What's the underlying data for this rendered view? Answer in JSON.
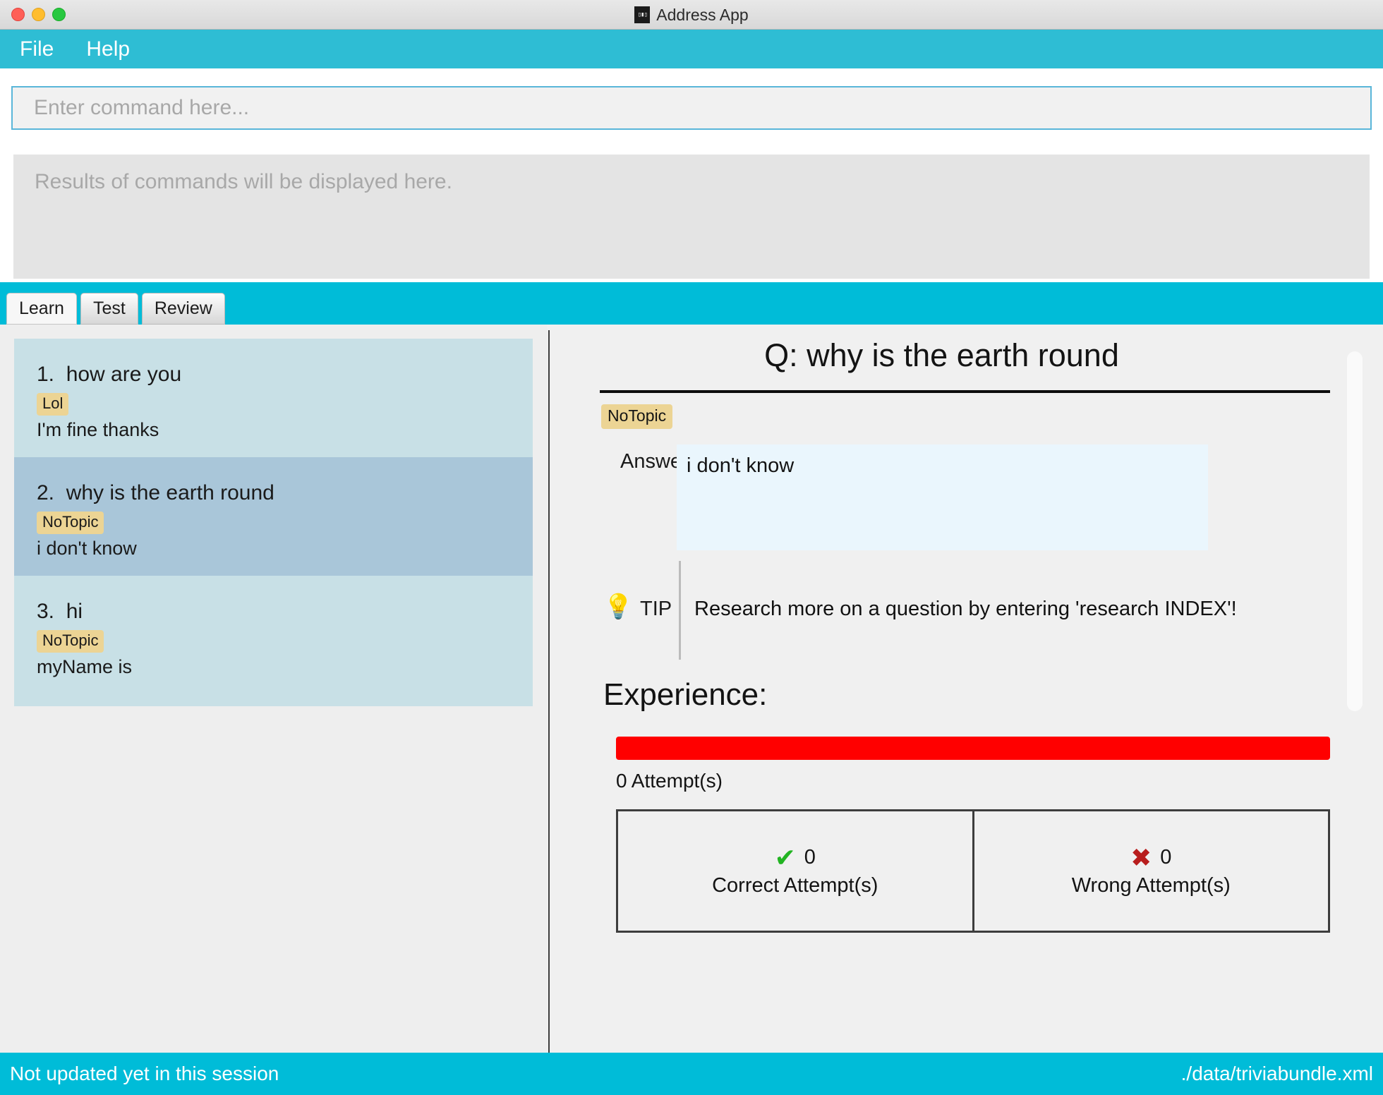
{
  "window": {
    "title": "Address App",
    "app_icon": "app-icon",
    "traffic_lights": [
      "close-red",
      "minimize-yellow",
      "zoom-green"
    ]
  },
  "menubar": {
    "items": [
      {
        "label": "File"
      },
      {
        "label": "Help"
      }
    ]
  },
  "command": {
    "value": "",
    "placeholder": "Enter command here..."
  },
  "result": {
    "placeholder": "Results of commands will be displayed here."
  },
  "tabs": [
    {
      "label": "Learn",
      "active": true
    },
    {
      "label": "Test",
      "active": false
    },
    {
      "label": "Review",
      "active": false
    }
  ],
  "list": {
    "items": [
      {
        "index": "1.",
        "question": "how are you",
        "tag": "Lol",
        "answer": "I'm fine thanks",
        "selected": false
      },
      {
        "index": "2.",
        "question": "why is the earth round",
        "tag": "NoTopic",
        "answer": "i don't know",
        "selected": true
      },
      {
        "index": "3.",
        "question": "hi",
        "tag": "NoTopic",
        "answer": "myName is",
        "selected": false
      }
    ]
  },
  "detail": {
    "question_heading": "Q: why is the earth round",
    "topic_tag": "NoTopic",
    "answer_label": "Answer:",
    "answer_text": "i don't know",
    "tip": {
      "icon": "lightbulb-icon",
      "label": "TIP",
      "text": "Research more on a question by entering 'research INDEX'!"
    },
    "experience": {
      "heading": "Experience:",
      "bar_color": "#ff0000",
      "bar_fill_percent": 100,
      "attempts_text": "0 Attempt(s)"
    },
    "attempt_stats": [
      {
        "icon": "check-icon",
        "count": "0",
        "label": "Correct Attempt(s)",
        "color": "#22b422"
      },
      {
        "icon": "cross-icon",
        "count": "0",
        "label": "Wrong Attempt(s)",
        "color": "#b81d1d"
      }
    ]
  },
  "statusbar": {
    "left": "Not updated yet in this session",
    "right": "./data/triviabundle.xml"
  },
  "colors": {
    "accent_teal": "#00bcd8",
    "menu_teal": "#2ebdd4",
    "tag_khaki": "#ecd494",
    "list_item": "#c8e0e6",
    "list_item_selected": "#a9c6d9",
    "answer_bg": "#eaf6fd"
  }
}
